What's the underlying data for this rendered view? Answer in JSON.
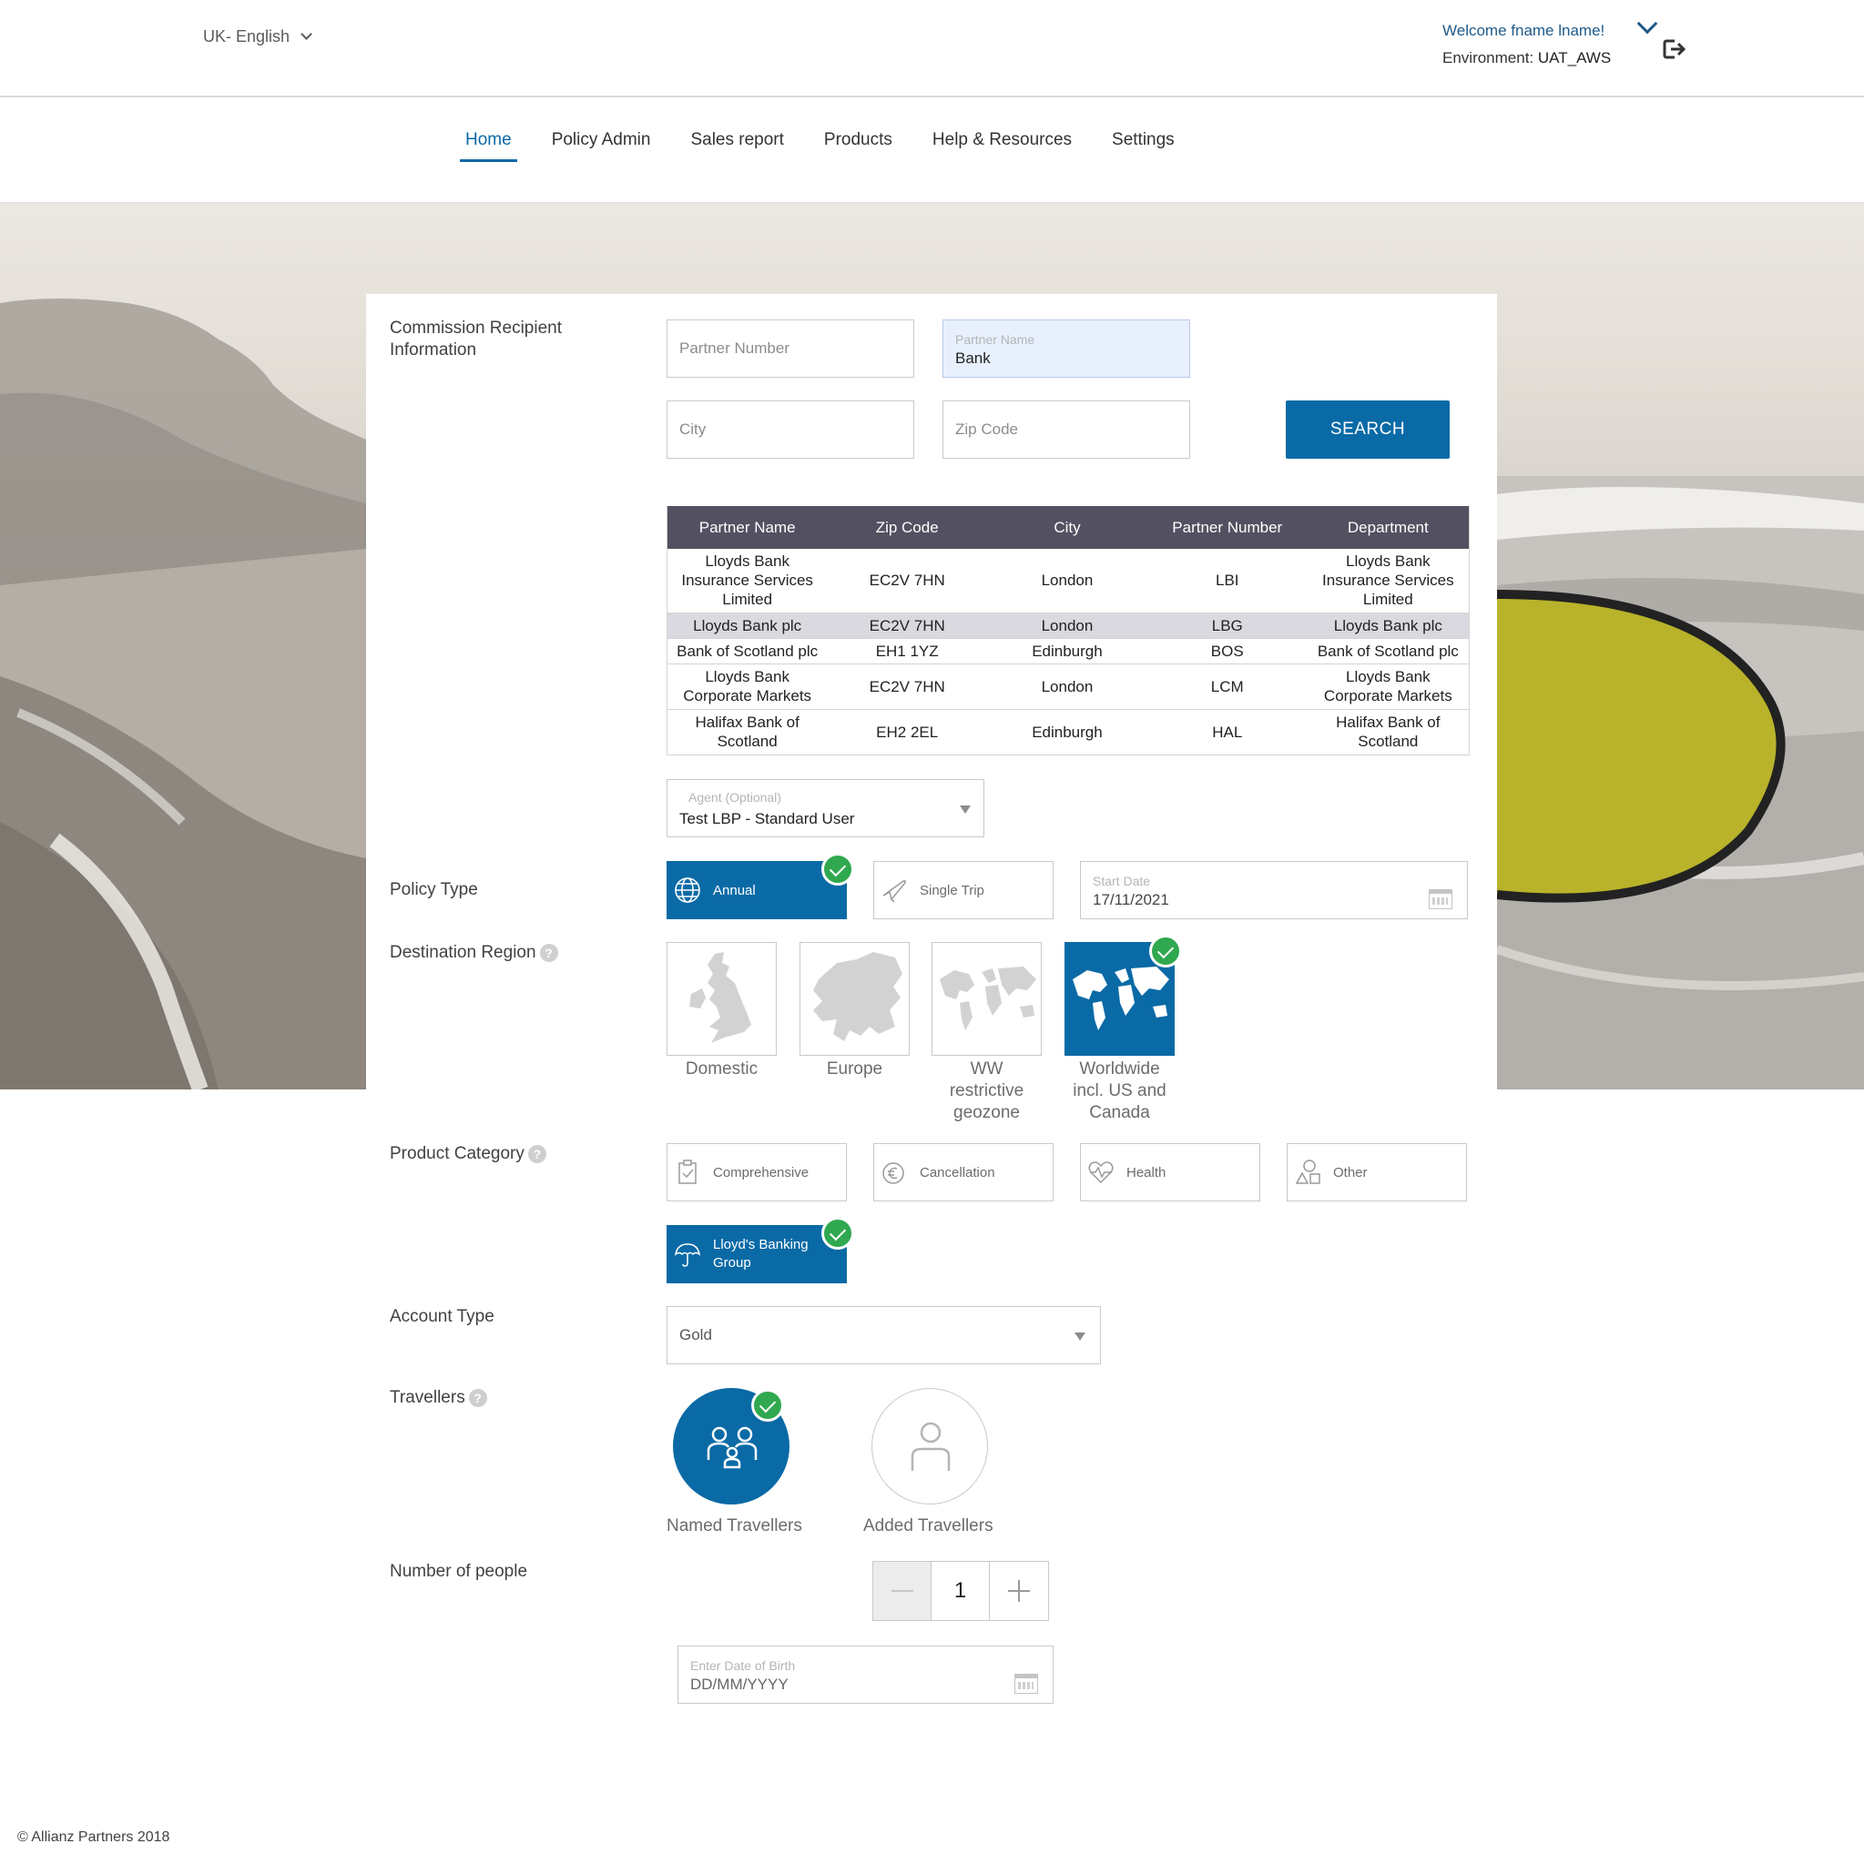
{
  "header": {
    "language": "UK- English",
    "welcome": "Welcome fname lname!",
    "environment_label": "Environment:",
    "environment_value": "UAT_AWS"
  },
  "nav": {
    "items": [
      "Home",
      "Policy Admin",
      "Sales report",
      "Products",
      "Help & Resources",
      "Settings"
    ],
    "active": "Home"
  },
  "commission": {
    "label": "Commission Recipient Information",
    "partner_number_placeholder": "Partner Number",
    "partner_name_label": "Partner Name",
    "partner_name_value": "Bank",
    "city_placeholder": "City",
    "zip_placeholder": "Zip Code",
    "search_button": "SEARCH"
  },
  "results": {
    "columns": [
      "Partner Name",
      "Zip Code",
      "City",
      "Partner Number",
      "Department"
    ],
    "rows": [
      [
        "Lloyds Bank Insurance Services Limited",
        "EC2V 7HN",
        "London",
        "LBI",
        "Lloyds Bank Insurance Services Limited"
      ],
      [
        "Lloyds Bank plc",
        "EC2V 7HN",
        "London",
        "LBG",
        "Lloyds Bank plc"
      ],
      [
        "Bank of Scotland plc",
        "EH1 1YZ",
        "Edinburgh",
        "BOS",
        "Bank of Scotland plc"
      ],
      [
        "Lloyds Bank Corporate Markets",
        "EC2V 7HN",
        "London",
        "LCM",
        "Lloyds Bank Corporate Markets"
      ],
      [
        "Halifax Bank of Scotland",
        "EH2 2EL",
        "Edinburgh",
        "HAL",
        "Halifax Bank of Scotland"
      ]
    ],
    "selected_row": 1
  },
  "agent": {
    "label": "Agent (Optional)",
    "value": "Test LBP - Standard User"
  },
  "policy_type": {
    "label": "Policy Type",
    "options": [
      {
        "label": "Annual",
        "icon": "globe-icon",
        "selected": true
      },
      {
        "label": "Single Trip",
        "icon": "plane-icon",
        "selected": false
      }
    ],
    "start_date_label": "Start Date",
    "start_date_value": "17/11/2021"
  },
  "destination": {
    "label": "Destination Region",
    "options": [
      {
        "label": "Domestic",
        "selected": false
      },
      {
        "label": "Europe",
        "selected": false
      },
      {
        "label": "WW restrictive geozone",
        "selected": false
      },
      {
        "label": "Worldwide incl. US and Canada",
        "selected": true
      }
    ]
  },
  "product_category": {
    "label": "Product Category",
    "options": [
      {
        "label": "Comprehensive",
        "icon": "clipboard-check-icon",
        "selected": false
      },
      {
        "label": "Cancellation",
        "icon": "euro-cancel-icon",
        "selected": false
      },
      {
        "label": "Health",
        "icon": "heart-pulse-icon",
        "selected": false
      },
      {
        "label": "Other",
        "icon": "shapes-icon",
        "selected": false
      },
      {
        "label": "Lloyd's Banking Group",
        "icon": "umbrella-icon",
        "selected": true
      }
    ]
  },
  "account_type": {
    "label": "Account Type",
    "value": "Gold"
  },
  "travellers": {
    "label": "Travellers",
    "options": [
      {
        "label": "Named Travellers",
        "icon": "family-icon",
        "selected": true
      },
      {
        "label": "Added Travellers",
        "icon": "person-icon",
        "selected": false
      }
    ]
  },
  "people": {
    "label": "Number of people",
    "count": "1",
    "dob_label": "Enter Date of Birth",
    "dob_placeholder": "DD/MM/YYYY"
  },
  "footer": {
    "copyright": "© Allianz Partners 2018"
  },
  "colors": {
    "primary": "#0a6aa6",
    "table_header": "#535061",
    "check": "#2fa84f",
    "welcome_text": "#1e5a8a"
  }
}
